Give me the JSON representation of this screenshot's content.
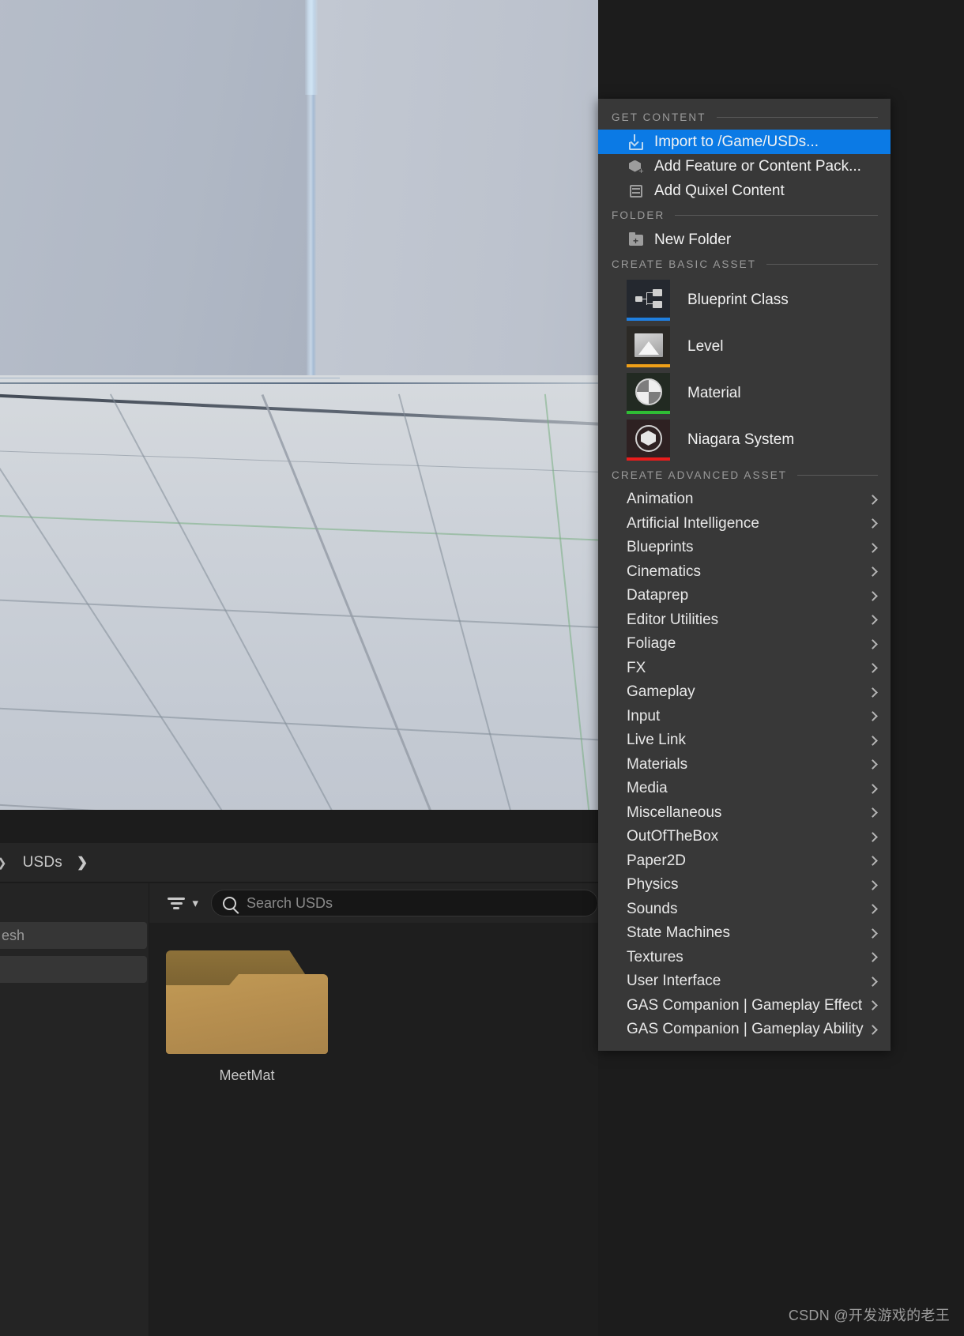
{
  "viewport": {
    "name": "level-viewport"
  },
  "content_browser": {
    "breadcrumb": {
      "label": "USDs",
      "chevron": "❯",
      "prev_arrow": "❯"
    },
    "left_panel_partial_item": "esh",
    "filter_label": "filter-icon",
    "search": {
      "placeholder": "Search USDs",
      "value": ""
    },
    "assets": [
      {
        "name": "MeetMat",
        "type": "folder"
      }
    ]
  },
  "context_menu": {
    "sections": [
      {
        "title": "GET CONTENT",
        "items": [
          {
            "label": "Import to /Game/USDs...",
            "icon": "import-icon",
            "selected": true
          },
          {
            "label": "Add Feature or Content Pack...",
            "icon": "feature-pack-icon",
            "selected": false
          },
          {
            "label": "Add Quixel Content",
            "icon": "quixel-icon",
            "selected": false
          }
        ]
      },
      {
        "title": "FOLDER",
        "items": [
          {
            "label": "New Folder",
            "icon": "new-folder-icon",
            "selected": false
          }
        ]
      },
      {
        "title": "CREATE BASIC ASSET",
        "assets": [
          {
            "label": "Blueprint Class",
            "icon": "blueprint-icon",
            "bar_color": "#1f7fe0",
            "bg_color": "#24282f"
          },
          {
            "label": "Level",
            "icon": "level-icon",
            "bar_color": "#f0a018",
            "bg_color": "#2c2a26"
          },
          {
            "label": "Material",
            "icon": "material-icon",
            "bar_color": "#2fbd35",
            "bg_color": "#222a22"
          },
          {
            "label": "Niagara System",
            "icon": "niagara-icon",
            "bar_color": "#ea1c1c",
            "bg_color": "#2e2122"
          }
        ]
      },
      {
        "title": "CREATE ADVANCED ASSET",
        "submenus": [
          "Animation",
          "Artificial Intelligence",
          "Blueprints",
          "Cinematics",
          "Dataprep",
          "Editor Utilities",
          "Foliage",
          "FX",
          "Gameplay",
          "Input",
          "Live Link",
          "Materials",
          "Media",
          "Miscellaneous",
          "OutOfTheBox",
          "Paper2D",
          "Physics",
          "Sounds",
          "State Machines",
          "Textures",
          "User Interface",
          "GAS Companion | Gameplay Effect",
          "GAS Companion | Gameplay Ability"
        ]
      }
    ],
    "highlight_color": "#0b7ae5"
  },
  "watermark": {
    "text": "CSDN @开发游戏的老王"
  }
}
